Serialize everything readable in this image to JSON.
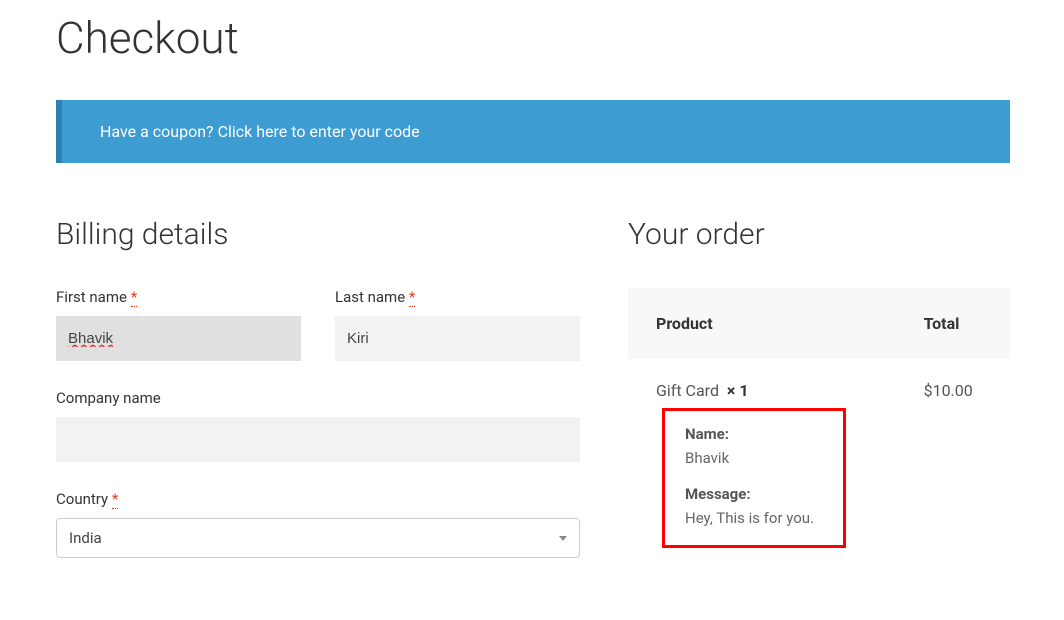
{
  "page_title": "Checkout",
  "coupon_notice": "Have a coupon? Click here to enter your code",
  "billing": {
    "title": "Billing details",
    "first_name": {
      "label": "First name",
      "required": "*",
      "value": "Bhavik"
    },
    "last_name": {
      "label": "Last name",
      "required": "*",
      "value": "Kiri"
    },
    "company": {
      "label": "Company name",
      "value": ""
    },
    "country": {
      "label": "Country",
      "required": "*",
      "selected": "India"
    }
  },
  "order": {
    "title": "Your order",
    "headers": {
      "product": "Product",
      "total": "Total"
    },
    "item": {
      "name": "Gift Card",
      "qty_prefix": "×",
      "qty": "1",
      "price": "$10.00"
    },
    "meta": {
      "name_label": "Name:",
      "name_value": "Bhavik",
      "message_label": "Message:",
      "message_value": "Hey, This is for you."
    }
  }
}
